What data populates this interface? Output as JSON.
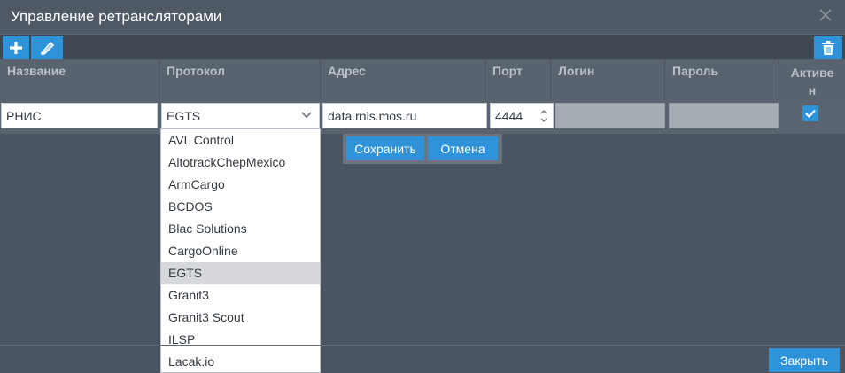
{
  "window": {
    "title": "Управление ретрансляторами"
  },
  "table": {
    "headers": {
      "name": "Название",
      "protocol": "Протокол",
      "address": "Адрес",
      "port": "Порт",
      "login": "Логин",
      "password": "Пароль",
      "active_line1": "Активе",
      "active_line2": "н"
    },
    "row": {
      "name": "РНИС",
      "protocol": "EGTS",
      "address": "data.rnis.mos.ru",
      "port": "4444",
      "login": "",
      "password": "",
      "active": true
    }
  },
  "actions": {
    "save_label": "Сохранить",
    "cancel_label": "Отмена"
  },
  "protocol_options": [
    "AVL Control",
    "AltotrackChepMexico",
    "ArmCargo",
    "BCDOS",
    "Blac Solutions",
    "CargoOnline",
    "EGTS",
    "Granit3",
    "Granit3 Scout",
    "ILSP",
    "Lacak.io"
  ],
  "protocol_selected": "EGTS",
  "footer": {
    "close_label": "Закрыть"
  },
  "icons": {
    "add": "plus-icon",
    "edit": "pencil-icon",
    "delete": "trash-icon",
    "close": "close-icon",
    "dropdown": "chevron-down-icon",
    "spinner": "spinner-arrows-icon",
    "check": "check-icon"
  },
  "colors": {
    "accent": "#2f93d9",
    "background": "#4b5562",
    "header": "#59636f",
    "selected_option": "#d6d8db"
  }
}
